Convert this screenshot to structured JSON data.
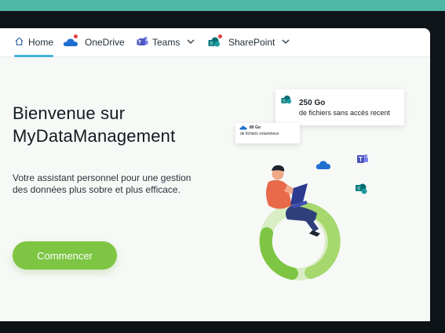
{
  "nav": {
    "home": "Home",
    "onedrive": "OneDrive",
    "teams": "Teams",
    "sharepoint": "SharePoint"
  },
  "hero": {
    "title_line1": "Bienvenue sur",
    "title_line2": "MyDataManagement",
    "subtitle_line1": "Votre assistant personnel pour une gestion",
    "subtitle_line2": "des données plus sobre et plus efficace.",
    "cta_label": "Commencer"
  },
  "stats": {
    "no_access": {
      "value": "250 Go",
      "label": "de fichiers sans accès recent"
    },
    "large_files": {
      "value": "80 Go",
      "label": "de fichiers volumineux"
    }
  },
  "colors": {
    "accent_green": "#7dc543",
    "nav_underline": "#45b3d9",
    "top_strip": "#4fb7a6",
    "notification_dot": "#e04040"
  },
  "icons": [
    "home-icon",
    "onedrive-icon",
    "teams-icon",
    "sharepoint-icon",
    "chevron-down-icon"
  ]
}
